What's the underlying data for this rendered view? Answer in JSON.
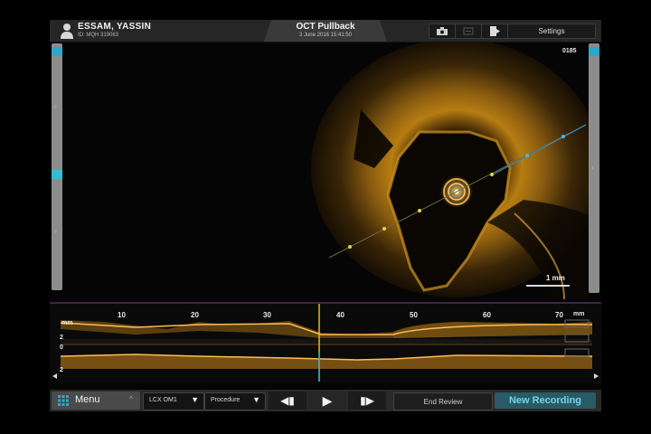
{
  "header": {
    "patient_name": "ESSAM, YASSIN",
    "patient_id": "ID: MQH 319063",
    "title": "OCT Pullback",
    "date": "3 June 2016 15:41:50",
    "settings_label": "Settings",
    "icons": [
      "camera-icon",
      "bookmark-icon",
      "export-icon",
      "gear-icon"
    ]
  },
  "viewer": {
    "frame_number": "0185",
    "scale_label": "1 mm"
  },
  "longitudinal": {
    "unit_left": "mm",
    "unit_right": "mm",
    "depth_labels": [
      "2",
      "0",
      "2"
    ],
    "ticks": [
      "10",
      "20",
      "30",
      "40",
      "50",
      "60",
      "70"
    ]
  },
  "toolbar": {
    "menu_label": "Menu",
    "vessel_select": "LCX OM1",
    "procedure_select": "Procedure",
    "end_review_label": "End Review",
    "new_recording_label": "New Recording"
  },
  "colors": {
    "accent": "#2aa8c8",
    "oct_tissue": "#c8901e",
    "cursor": "#e0c020"
  }
}
